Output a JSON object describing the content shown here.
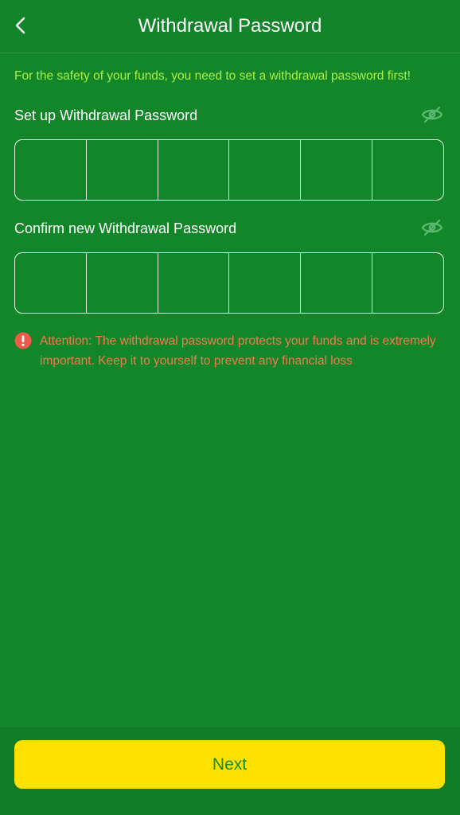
{
  "header": {
    "title": "Withdrawal Password",
    "back_icon": "chevron-left-icon"
  },
  "notice": "For the safety of your funds, you need to set a withdrawal password first!",
  "setup_field": {
    "label": "Set up Withdrawal Password",
    "toggle_icon": "eye-off-icon",
    "digits": [
      "",
      "",
      "",
      "",
      "",
      ""
    ]
  },
  "confirm_field": {
    "label": "Confirm new Withdrawal Password",
    "toggle_icon": "eye-off-icon",
    "digits": [
      "",
      "",
      "",
      "",
      "",
      ""
    ]
  },
  "attention": {
    "icon": "exclamation-circle-icon",
    "text": "Attention: The withdrawal password protects your funds and is extremely important. Keep it to yourself to prevent any financial loss"
  },
  "footer": {
    "next_label": "Next"
  },
  "colors": {
    "background": "#14862a",
    "notice_text": "#a8f040",
    "attention_text": "#f07a4e",
    "button_bg": "#ffe100",
    "button_text": "#158a2c"
  }
}
